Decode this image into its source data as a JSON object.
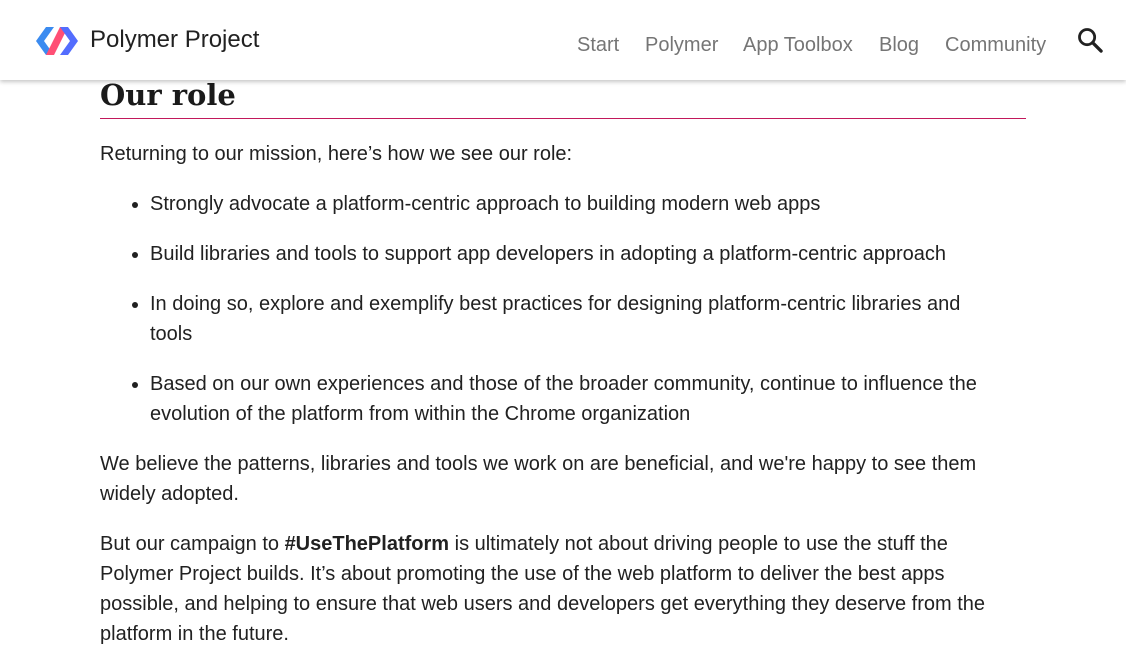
{
  "header": {
    "brand": "Polymer Project",
    "nav": [
      {
        "label": "Start"
      },
      {
        "label": "Polymer"
      },
      {
        "label": "App Toolbox"
      },
      {
        "label": "Blog"
      },
      {
        "label": "Community"
      }
    ],
    "search_icon": "search-icon",
    "logo_icon": "polymer-logo-icon",
    "colors": {
      "logo_blue": "#3b8bf0",
      "logo_red": "#ff4f75",
      "logo_dark": "#536dfe"
    }
  },
  "section": {
    "title": "Our role",
    "accent_color": "#c2185b",
    "intro": "Returning to our mission, here’s how we see our role:",
    "bullets": [
      "Strongly advocate a platform-centric approach to building modern web apps",
      "Build libraries and tools to support app developers in adopting a platform-centric approach",
      "In doing so, explore and exemplify best practices for designing platform-centric libraries and tools",
      "Based on our own experiences and those of the broader community, continue to influence the evolution of the platform from within the Chrome organization"
    ],
    "para1": "We believe the patterns, libraries and tools we work on are beneficial, and we're happy to see them widely adopted.",
    "para2_before": "But our campaign to ",
    "para2_bold": "#UseThePlatform",
    "para2_after": " is ultimately not about driving people to use the stuff the Polymer Project builds. It’s about promoting the use of the web platform to deliver the best apps possible, and helping to ensure that web users and developers get everything they deserve from the platform in the future."
  }
}
